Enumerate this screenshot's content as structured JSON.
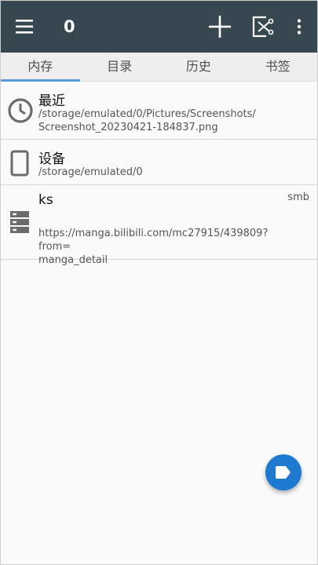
{
  "toolbar": {
    "count": "0",
    "menu_icon": "hamburger-menu-icon",
    "add_icon": "plus-icon",
    "cut_icon": "cut-file-icon",
    "more_icon": "more-vert-icon",
    "background": "#37474f"
  },
  "tabs": [
    {
      "label": "内存",
      "active": true
    },
    {
      "label": "目录",
      "active": false
    },
    {
      "label": "历史",
      "active": false
    },
    {
      "label": "书签",
      "active": false
    }
  ],
  "items": [
    {
      "icon": "clock-icon",
      "title": "最近",
      "path": "/storage/emulated/0/Pictures/Screenshots/\nScreenshot_20230421-184837.png",
      "tag": ""
    },
    {
      "icon": "phone-device-icon",
      "title": "设备",
      "path": "/storage/emulated/0",
      "tag": ""
    },
    {
      "icon": "server-icon",
      "title": "ks",
      "path": "https://manga.bilibili.com/mc27915/439809?from=\nmanga_detail",
      "tag": "smb"
    }
  ],
  "fab": {
    "icon": "label-tag-icon",
    "color": "#1e7ad0"
  }
}
